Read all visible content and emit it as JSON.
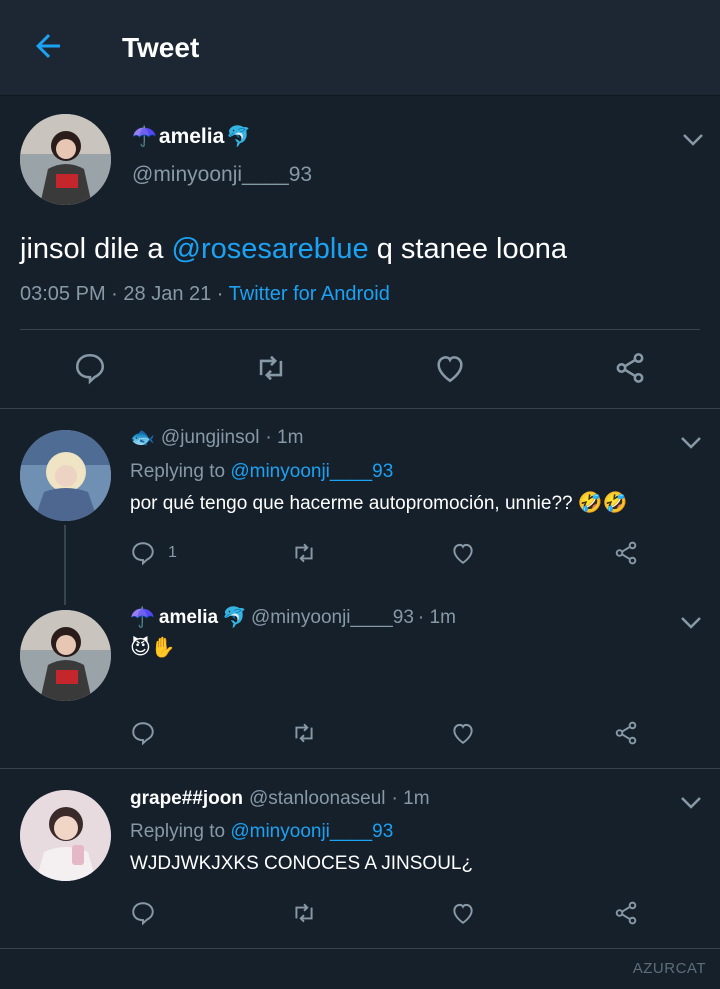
{
  "header": {
    "title": "Tweet",
    "back_icon": "arrow-left-icon"
  },
  "colors": {
    "background": "#15202b",
    "header": "#1c2733",
    "accent": "#1da1f2",
    "muted": "#8899a6",
    "border": "#38444d"
  },
  "main_tweet": {
    "name": "amelia",
    "name_prefix_emoji": "☂️",
    "name_suffix_emoji": "🐬",
    "handle": "@minyoonji____93",
    "text_before": "jinsol dile a ",
    "mention": "@rosesareblue",
    "text_after": " q stanee loona",
    "time": "03:05 PM",
    "dot1": " · ",
    "date": "28 Jan 21",
    "dot2": " · ",
    "source": "Twitter for Android"
  },
  "replies": [
    {
      "name_emoji": "🐟",
      "handle": "@jungjinsol",
      "time": "· 1m",
      "replying_label": "Replying to ",
      "replying_handle": "@minyoonji____93",
      "text": "por qué tengo que hacerme autopromoción, unnie??",
      "text_emoji": "🤣🤣",
      "reply_count": "1"
    },
    {
      "name": "amelia",
      "name_prefix_emoji": "☂️",
      "name_suffix_emoji": "🐬",
      "handle": "@minyoonji____93",
      "time": "· 1m",
      "text_emoji": "😈✋"
    },
    {
      "name": "grape##joon",
      "handle": "@stanloonaseul",
      "time": "· 1m",
      "replying_label": "Replying to ",
      "replying_handle": "@minyoonji____93",
      "text": "WJDJWKJXKS CONOCES A JINSOUL¿"
    }
  ],
  "watermark": "AZURCAT"
}
